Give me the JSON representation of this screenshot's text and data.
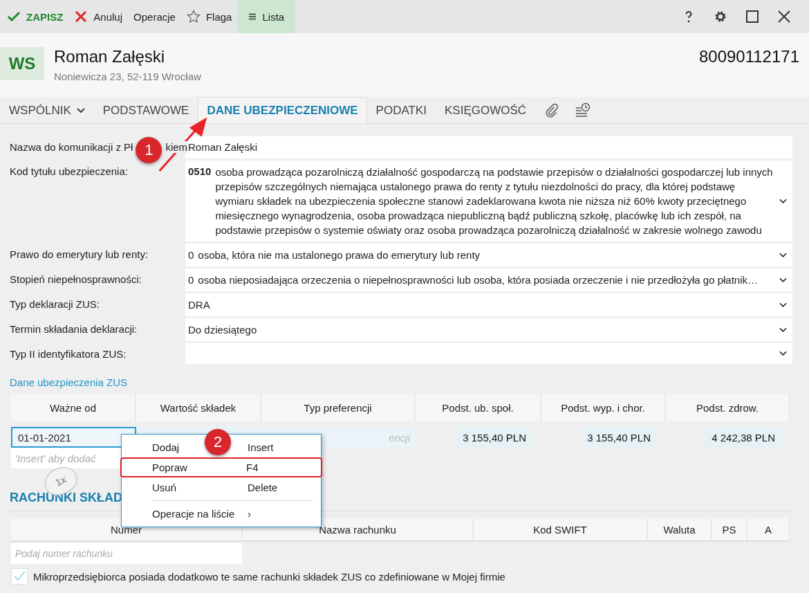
{
  "toolbar": {
    "buttons": [
      {
        "label": "ZAPISZ",
        "kind": "save",
        "selected": false
      },
      {
        "label": "Anuluj",
        "kind": "cancel",
        "selected": false
      },
      {
        "label": "Operacje",
        "kind": "plain",
        "selected": false
      },
      {
        "label": "Flaga",
        "kind": "flag",
        "selected": false
      },
      {
        "label": "Lista",
        "kind": "list",
        "selected": true
      }
    ]
  },
  "header": {
    "badge": "WS",
    "name": "Roman Załęski",
    "address": "Noniewicza 23, 52-119 Wrocław",
    "number": "80090112171"
  },
  "tabs": [
    {
      "label": "WSPÓLNIK",
      "kind": "dropdown",
      "selected": false
    },
    {
      "label": "PODSTAWOWE",
      "kind": "text",
      "selected": false
    },
    {
      "label": "DANE UBEZPIECZENIOWE",
      "kind": "text",
      "selected": true
    },
    {
      "label": "PODATKI",
      "kind": "text",
      "selected": false
    },
    {
      "label": "KSIĘGOWOŚĆ",
      "kind": "text",
      "selected": false
    },
    {
      "kind": "attachment"
    },
    {
      "kind": "history"
    }
  ],
  "form": [
    {
      "label": "Nazwa do komunikacji z Pł",
      "label_tail": "kiem",
      "kind": "text",
      "value": "Roman Załęski"
    },
    {
      "label": "Kod tytułu ubezpieczenia:",
      "kind": "select",
      "code": "0510",
      "value": "osoba prowadząca pozarolniczą działalność gospodarczą na podstawie przepisów o działalności gospodarczej lub innych przepisów szczególnych niemająca ustalonego prawa do renty z tytułu niezdolności do pracy, dla której podstawę wymiaru składek na ubezpieczenia społeczne stanowi zadeklarowana kwota nie niższa niż 60% kwoty przeciętnego miesięcznego wynagrodzenia, osoba prowadząca niepubliczną bądź publiczną szkołę, placówkę lub ich zespół, na podstawie przepisów o systemie oświaty oraz osoba prowadząca pozarolniczą działalność w zakresie wolnego zawodu"
    },
    {
      "label": "Prawo do emerytury lub renty:",
      "kind": "select",
      "code": "0",
      "value": "osoba, która nie ma ustalonego prawa do emerytury lub renty"
    },
    {
      "label": "Stopień niepełnosprawności:",
      "kind": "select",
      "code": "0",
      "value": "osoba nieposiadająca orzeczenia o niepełnosprawności lub osoba, która posiada orzeczenie i nie przedłożyła go płatnik…"
    },
    {
      "label": "Typ deklaracji ZUS:",
      "kind": "select",
      "value": "DRA"
    },
    {
      "label": "Termin składania deklaracji:",
      "kind": "select",
      "value": "Do dziesiątego"
    },
    {
      "label": "Typ II identyfikatora ZUS:",
      "kind": "select"
    }
  ],
  "insurance": {
    "title": "Dane ubezpieczenia ZUS",
    "columns": [
      "Ważne od",
      "Wartość składek",
      "Typ preferencji",
      "Podst. ub. społ.",
      "Podst. wyp. i chor.",
      "Podst. zdrow."
    ],
    "rows": [
      {
        "cells": [
          "01-01-2021",
          "",
          "encji",
          "3 155,40 PLN",
          "3 155,40 PLN",
          "4 242,38 PLN"
        ],
        "selected": true
      }
    ],
    "placeholder": "'Insert' aby dodać"
  },
  "context_menu": {
    "items": [
      {
        "label": "Dodaj",
        "shortcut": "Insert",
        "selected": false
      },
      {
        "label": "Popraw",
        "shortcut": "F4",
        "selected": true
      },
      {
        "label": "Usuń",
        "shortcut": "Delete",
        "selected": false
      },
      {
        "label": "Operacje na liście",
        "shortcut": "›",
        "selected": false
      }
    ]
  },
  "accounts": {
    "title": "RACHUNKI SKŁAD",
    "columns": [
      "Numer",
      "Nazwa rachunku",
      "Kod SWIFT",
      "Waluta",
      "PS",
      "A"
    ],
    "placeholder": "Podaj numer rachunku",
    "checkbox": {
      "label": "Mikroprzedsiębiorca posiada dodatkowo te same rachunki składek ZUS co zdefiniowane w Mojej firmie",
      "checked": true
    }
  },
  "annotations": [
    {
      "label": "1"
    },
    {
      "label": "2"
    },
    {
      "label": "1x"
    }
  ]
}
